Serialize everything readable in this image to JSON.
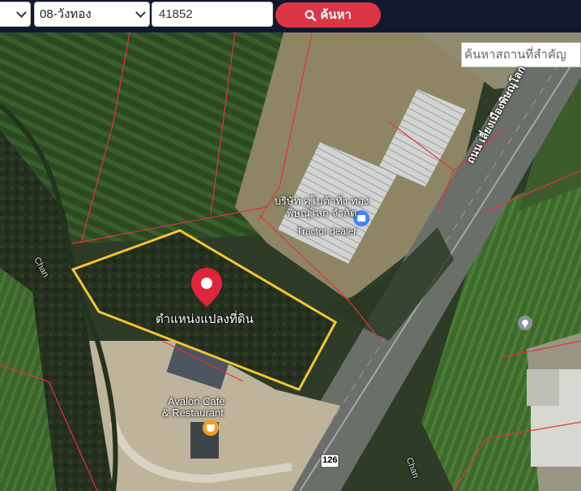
{
  "toolbar": {
    "select_first_value": "",
    "district_select_value": "08-วังทอง",
    "parcel_input_value": "41852",
    "search_button_label": "ค้นหา"
  },
  "map": {
    "place_search_placeholder": "ค้นหาสถานที่สำคัญ",
    "marker_label": "ตำแหน่งแปลงที่ดิน",
    "business_name": "บริษัท คูโบต้าทั่ง ทองพิษณุโลก จำกัด",
    "business_category": "Tractor dealer",
    "cafe_name_line1": "Avalon Cafe",
    "cafe_name_line2": "& Restaurant",
    "road_name": "ถนน เลี่ยงเมืองพิษณุโลก",
    "route_shield": "126",
    "canal_label_left": "Chan",
    "canal_label_bottom": "Chan",
    "colors": {
      "parcel_outline": "#f5c531",
      "marker": "#e0243c",
      "boundary_lines": "#e8303a",
      "search_button": "#dc3545"
    }
  }
}
